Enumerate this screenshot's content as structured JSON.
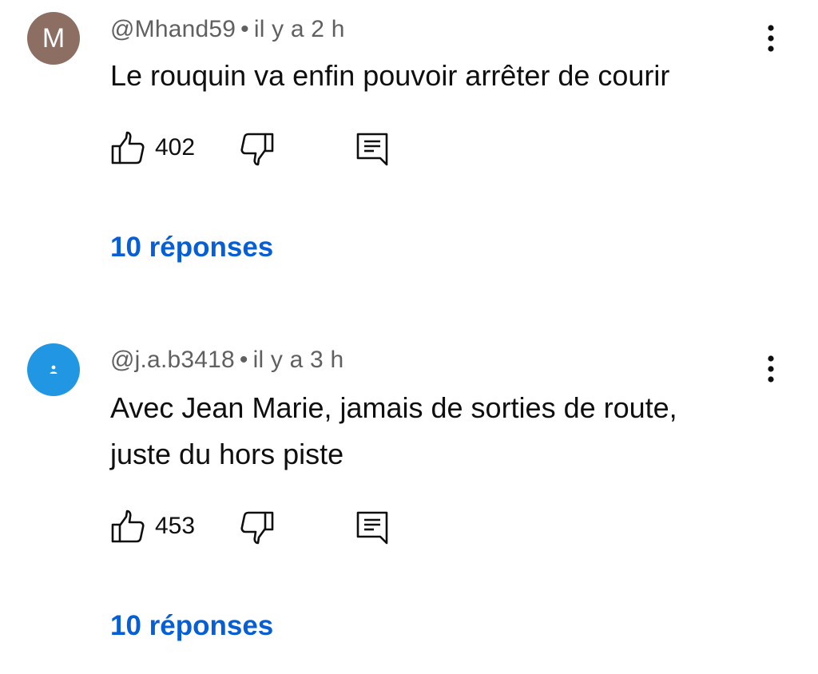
{
  "comments": [
    {
      "avatar_letter": "M",
      "avatar_color": "#8d6e63",
      "author": "@Mhand59",
      "separator": "•",
      "time": "il y a 2 h",
      "text_lines": [
        "Le rouquin va enfin pouvoir arrêter de courir"
      ],
      "likes": "402",
      "replies_label": "10 réponses"
    },
    {
      "avatar_icon": "person-icon",
      "avatar_color": "#2196e3",
      "author": "@j.a.b3418",
      "separator": "•",
      "time": "il y a 3 h",
      "text_lines": [
        "Avec Jean Marie, jamais de sorties de route,",
        "juste du hors piste"
      ],
      "likes": "453",
      "replies_label": "10 réponses"
    }
  ],
  "colors": {
    "reply_link": "#065fd4",
    "meta_text": "#606060"
  },
  "icons": {
    "like": "thumbs-up-icon",
    "dislike": "thumbs-down-icon",
    "reply": "reply-comment-icon",
    "menu": "more-vertical-icon"
  }
}
